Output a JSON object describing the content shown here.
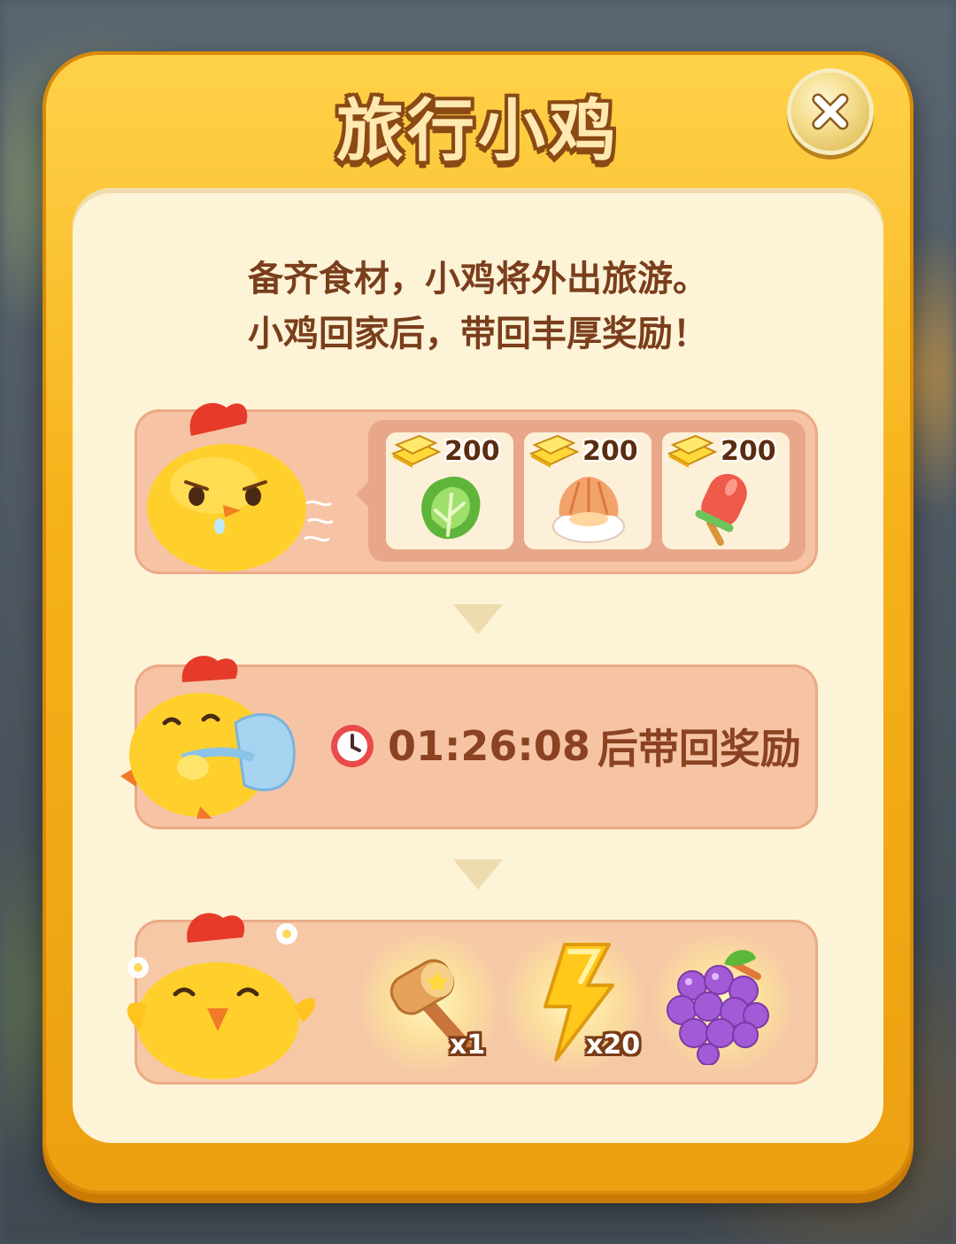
{
  "dialog": {
    "title": "旅行小鸡",
    "close_label": "×"
  },
  "description": {
    "line1": "备齐食材，小鸡将外出旅游。",
    "line2": "小鸡回家后，带回丰厚奖励！"
  },
  "step1": {
    "chick_mood": "hungry",
    "foods": [
      {
        "icon": "lettuce-icon",
        "cost_icon": "gold-bars-icon",
        "cost": "200"
      },
      {
        "icon": "scallop-icon",
        "cost_icon": "gold-bars-icon",
        "cost": "200"
      },
      {
        "icon": "popsicle-icon",
        "cost_icon": "gold-bars-icon",
        "cost": "200"
      }
    ]
  },
  "step2": {
    "timer_icon": "clock-icon",
    "countdown": "01:26:08",
    "suffix": "后带回奖励"
  },
  "step3": {
    "rewards": [
      {
        "icon": "hammer-icon",
        "quantity": "x1"
      },
      {
        "icon": "lightning-icon",
        "quantity": "x20"
      },
      {
        "icon": "grapes-icon",
        "quantity": ""
      }
    ]
  },
  "colors": {
    "frame": "#f6b21a",
    "panel": "#fdf3d7",
    "row": "#f6c4a4",
    "text_brown": "#7a3e1c"
  }
}
